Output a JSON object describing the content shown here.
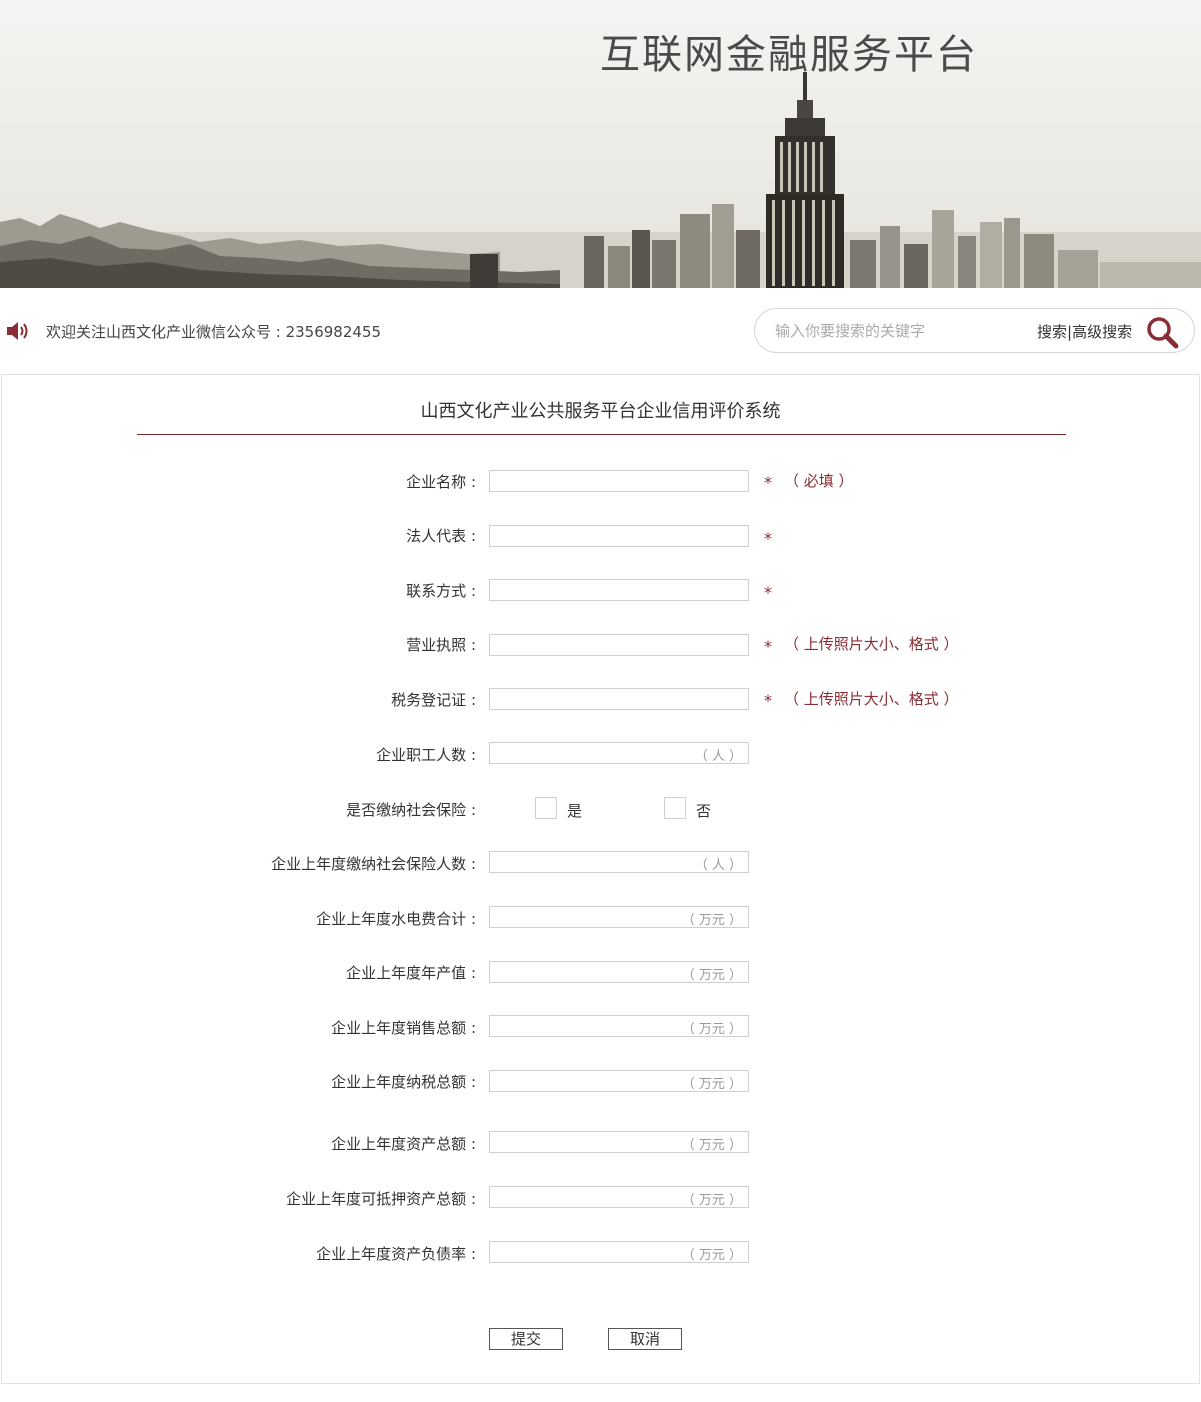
{
  "banner": {
    "title": "互联网金融服务平台"
  },
  "notice": {
    "text": "欢迎关注山西文化产业微信公众号 : 2356982455"
  },
  "search": {
    "placeholder": "输入你要搜索的关键字",
    "search_label": "搜索",
    "separator": "|",
    "advanced_label": "高级搜索"
  },
  "form": {
    "title": "山西文化产业公共服务平台企业信用评价系统",
    "required_mark": "*",
    "fields": {
      "company_name": {
        "label": "企业名称 :",
        "hint": "（ 必填 ）"
      },
      "legal_rep": {
        "label": "法人代表 :"
      },
      "contact": {
        "label": "联系方式 :"
      },
      "business_license": {
        "label": "营业执照 :",
        "hint": "（ 上传照片大小、格式 ）"
      },
      "tax_cert": {
        "label": "税务登记证 :",
        "hint": "（ 上传照片大小、格式 ）"
      },
      "employees": {
        "label": "企业职工人数 :",
        "unit": "（ 人 ）"
      },
      "social_insurance": {
        "label": "是否缴纳社会保险 :",
        "yes": "是",
        "no": "否"
      },
      "insured_count": {
        "label": "企业上年度缴纳社会保险人数 :",
        "unit": "（ 人 ）"
      },
      "utilities": {
        "label": "企业上年度水电费合计 :",
        "unit": "（ 万元 ）"
      },
      "output_value": {
        "label": "企业上年度年产值 :",
        "unit": "（ 万元 ）"
      },
      "sales": {
        "label": "企业上年度销售总额 :",
        "unit": "（ 万元 ）"
      },
      "tax_total": {
        "label": "企业上年度纳税总额 :",
        "unit": "（ 万元 ）"
      },
      "assets": {
        "label": "企业上年度资产总额 :",
        "unit": "（ 万元 ）"
      },
      "mortgage_assets": {
        "label": "企业上年度可抵押资产总额 :",
        "unit": "（ 万元 ）"
      },
      "debt_ratio": {
        "label": "企业上年度资产负债率 :",
        "unit": "（ 万元 ）"
      }
    },
    "submit_label": "提交",
    "cancel_label": "取消"
  },
  "colors": {
    "accent": "#8b2d35",
    "rule": "#7d2930"
  }
}
